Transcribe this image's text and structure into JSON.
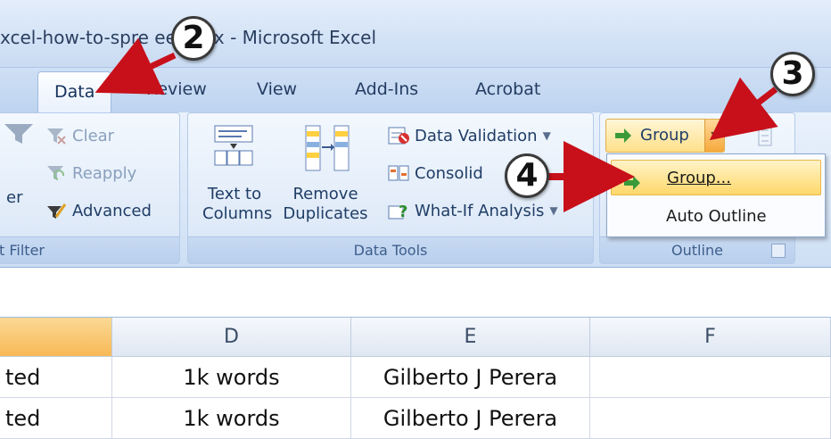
{
  "window": {
    "title": "xcel-how-to-spre eet.xlsx - Microsoft Excel"
  },
  "tabs": [
    {
      "label": "Data",
      "active": true
    },
    {
      "label": "Review"
    },
    {
      "label": "View"
    },
    {
      "label": "Add-Ins"
    },
    {
      "label": "Acrobat"
    }
  ],
  "ribbon": {
    "sort_filter": {
      "clear": "Clear",
      "reapply": "Reapply",
      "advanced": "Advanced",
      "filter_partial": "er",
      "label_partial": "t Filter"
    },
    "data_tools": {
      "text_to_columns_l1": "Text to",
      "text_to_columns_l2": "Columns",
      "remove_duplicates_l1": "Remove",
      "remove_duplicates_l2": "Duplicates",
      "data_validation": "Data Validation",
      "consolidate": "Consolid",
      "what_if": "What-If Analysis",
      "label": "Data Tools"
    },
    "outline": {
      "group": "Group",
      "label": "Outline"
    }
  },
  "dropdown": {
    "items": [
      {
        "label": "Group...",
        "highlighted": true
      },
      {
        "label": "Auto Outline"
      }
    ]
  },
  "grid": {
    "columns": [
      "D",
      "E",
      "F"
    ],
    "rows": [
      {
        "partial": "ted",
        "d": "1k words",
        "e": "Gilberto J Perera",
        "f": ""
      },
      {
        "partial": "ted",
        "d": "1k words",
        "e": "Gilberto J Perera",
        "f": ""
      }
    ]
  },
  "callouts": [
    "2",
    "3",
    "4"
  ],
  "colors": {
    "arrow": "#c8101a",
    "selected_header": "#f7b955",
    "highlight": "#ffd86b"
  }
}
